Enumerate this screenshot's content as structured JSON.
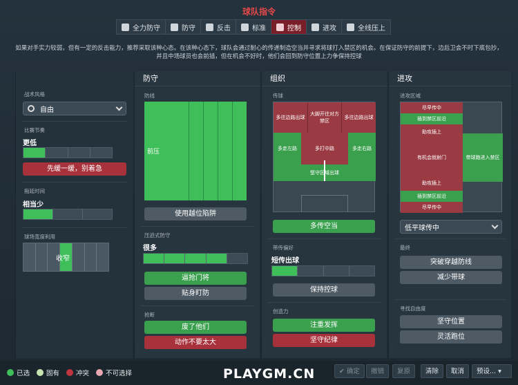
{
  "title": "球队指令",
  "tabs": [
    {
      "label": "全力防守",
      "icon": "shield-heart-icon"
    },
    {
      "label": "防守",
      "icon": "shield-icon"
    },
    {
      "label": "反击",
      "icon": "counter-icon"
    },
    {
      "label": "标准",
      "icon": "balance-icon"
    },
    {
      "label": "控制",
      "icon": "control-icon"
    },
    {
      "label": "进攻",
      "icon": "attack-icon"
    },
    {
      "label": "全线压上",
      "icon": "arrow-up-icon"
    }
  ],
  "description": "如果对手实力较弱，但有一定的反击能力，推荐采取该种心态。在该种心态下，球队会通过耐心的传递制造空当并寻求将球打入禁区的机会。在保证防守的前提下，边后卫会不时下底包抄，并且中场球员也会前插，但在机会不好时，他们会回到防守位置上力争保持控球",
  "left": {
    "style_label": "战术风格",
    "style_value": "自由",
    "tempo_label": "比赛节奏",
    "tempo_value": "更低",
    "tempo_fill": 0.3,
    "tempo_button": "先缓一缓，别着急",
    "timewaste_label": "拖延时间",
    "timewaste_value": "相当少",
    "timewaste_fill": 0.3,
    "width_label": "球场宽度利用",
    "width_value": "收窄"
  },
  "defense": {
    "header": "防守",
    "line_label": "防线",
    "line_value": "前压",
    "line_button": "使用越位陷阱",
    "press_label": "压迫式防守",
    "press_value": "很多",
    "press_fill": 0.8,
    "press_buttons": [
      "逼抢门将",
      "贴身盯防"
    ],
    "tackle_label": "抢断",
    "tackle_buttons": [
      "废了他们",
      "动作不要太大"
    ]
  },
  "organize": {
    "header": "组织",
    "pass_label": "传球",
    "pass_cells": [
      "多往边路出球",
      "大脚开往对方禁区",
      "多往边路出球",
      "多走左路",
      "多打中路",
      "多走右路",
      "堅守区域出球"
    ],
    "pass_button": "多传空当",
    "style_label": "带传偏好",
    "style_value": "短传出球",
    "style_fill": 0.25,
    "style_button": "保持控球",
    "create_label": "创造力",
    "create_buttons": [
      "注重发挥",
      "坚守纪律"
    ]
  },
  "attack": {
    "header": "进攻",
    "zone_label": "进攻区域",
    "zone_cells": [
      "尽早传中",
      "插到禁区前沿",
      "助攻插上",
      "有机会就射门",
      "助攻插上",
      "插到禁区前沿",
      "尽早传中",
      "带球跑进入禁区"
    ],
    "cross_value": "低平球传中",
    "final_label": "最终",
    "final_buttons": [
      "突破穿越防线",
      "减少带球"
    ],
    "extra_label": "寻找自由度",
    "extra_buttons": [
      "坚守位置",
      "灵活跑位"
    ]
  },
  "legend": [
    {
      "label": "已选",
      "color": "#3fbf5a"
    },
    {
      "label": "固有",
      "color": "#c8e6b0"
    },
    {
      "label": "冲突",
      "color": "#c0343f"
    },
    {
      "label": "不可选择",
      "color": "#e8a7b0"
    }
  ],
  "bottom_buttons": {
    "confirm": "确定",
    "undo": "撤销",
    "restore": "复原",
    "clear": "清除",
    "cancel": "取消",
    "preset": "预设..."
  },
  "watermark": "PLAYGM.CN"
}
